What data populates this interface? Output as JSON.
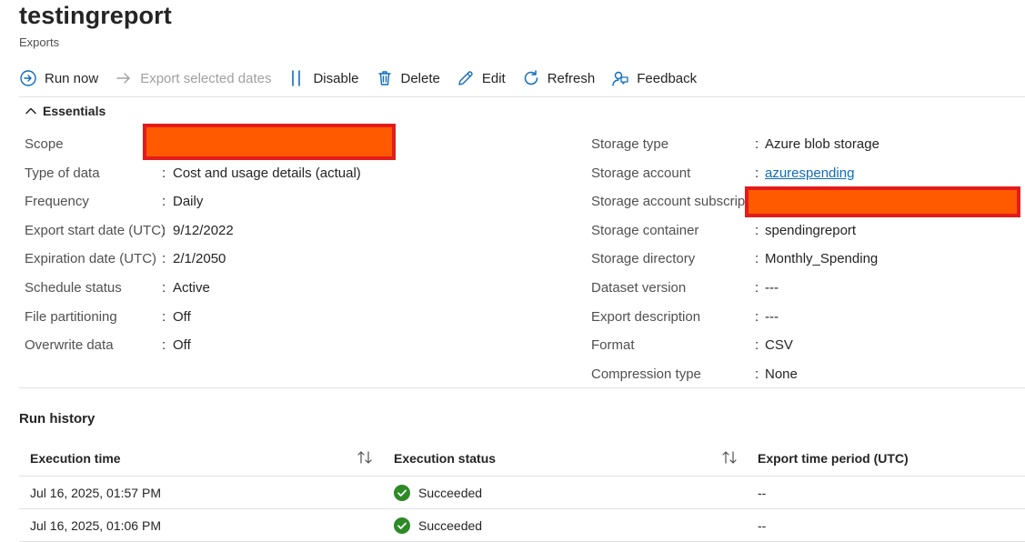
{
  "header": {
    "title": "testingreport",
    "subtitle": "Exports"
  },
  "toolbar": {
    "run_now": "Run now",
    "export_selected_dates": "Export selected dates",
    "disable": "Disable",
    "delete": "Delete",
    "edit": "Edit",
    "refresh": "Refresh",
    "feedback": "Feedback"
  },
  "essentials": {
    "toggle_label": "Essentials",
    "left": [
      {
        "label": "Scope",
        "value": ""
      },
      {
        "label": "Type of data",
        "value": "Cost and usage details (actual)"
      },
      {
        "label": "Frequency",
        "value": "Daily"
      },
      {
        "label": "Export start date (UTC)",
        "value": "9/12/2022"
      },
      {
        "label": "Expiration date (UTC)",
        "value": "2/1/2050"
      },
      {
        "label": "Schedule status",
        "value": "Active"
      },
      {
        "label": "File partitioning",
        "value": "Off"
      },
      {
        "label": "Overwrite data",
        "value": "Off"
      }
    ],
    "right": [
      {
        "label": "Storage type",
        "value": "Azure blob storage"
      },
      {
        "label": "Storage account",
        "value": "azurespending"
      },
      {
        "label": "Storage account subscrip...",
        "value": ""
      },
      {
        "label": "Storage container",
        "value": "spendingreport"
      },
      {
        "label": "Storage directory",
        "value": "Monthly_Spending"
      },
      {
        "label": "Dataset version",
        "value": "---"
      },
      {
        "label": "Export description",
        "value": "---"
      },
      {
        "label": "Format",
        "value": "CSV"
      },
      {
        "label": "Compression type",
        "value": "None"
      }
    ],
    "colon": ":"
  },
  "run_history": {
    "title": "Run history",
    "columns": [
      "Execution time",
      "Execution status",
      "Export time period (UTC)"
    ],
    "rows": [
      {
        "time": "Jul 16, 2025, 01:57 PM",
        "status": "Succeeded",
        "period": "--"
      },
      {
        "time": "Jul 16, 2025, 01:06 PM",
        "status": "Succeeded",
        "period": "--"
      }
    ]
  },
  "colors": {
    "accent": "#0f6cbd",
    "success": "#2e8a25",
    "redaction_fill": "#ff5a00",
    "redaction_border": "#e31b1b"
  }
}
